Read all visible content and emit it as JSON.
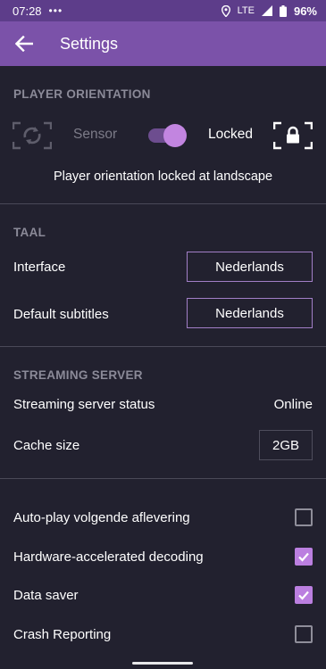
{
  "status_bar": {
    "time": "07:28",
    "dots": "•••",
    "network": "LTE",
    "battery": "96%"
  },
  "app_bar": {
    "title": "Settings"
  },
  "player_orientation": {
    "heading": "PLAYER ORIENTATION",
    "sensor_label": "Sensor",
    "locked_label": "Locked",
    "toggle_on": true,
    "message": "Player orientation locked at landscape"
  },
  "taal": {
    "heading": "TAAL",
    "interface_label": "Interface",
    "interface_value": "Nederlands",
    "subtitles_label": "Default subtitles",
    "subtitles_value": "Nederlands"
  },
  "streaming_server": {
    "heading": "STREAMING SERVER",
    "status_label": "Streaming server status",
    "status_value": "Online",
    "cache_label": "Cache size",
    "cache_value": "2GB"
  },
  "options": [
    {
      "label": "Auto-play volgende aflevering",
      "checked": false
    },
    {
      "label": "Hardware-accelerated decoding",
      "checked": true
    },
    {
      "label": "Data saver",
      "checked": true
    },
    {
      "label": "Crash Reporting",
      "checked": false
    }
  ],
  "colors": {
    "background": "#22212f",
    "app_bar": "#7b52a9",
    "status_bar": "#5d3d8a",
    "accent": "#bb7fe0"
  }
}
